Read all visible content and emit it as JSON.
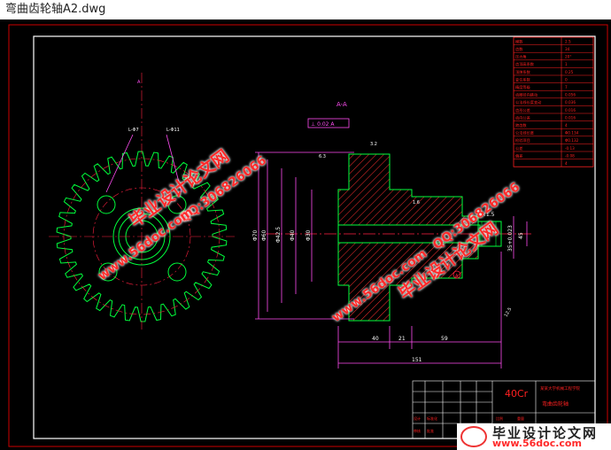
{
  "window": {
    "title": "弯曲齿轮轴A2.dwg"
  },
  "drawing": {
    "section_label": "A-A",
    "material": "40Cr",
    "dims": {
      "d1": "Φ70",
      "d2": "Φ60",
      "d3": "Φ42.5",
      "d4": "Φ40",
      "d5": "Φ30",
      "len_40": "40",
      "len_21": "21",
      "len_59": "59",
      "len_151": "151",
      "right_key": "45",
      "right_fit": "35+0.023",
      "thread_note": "5×1.5"
    },
    "roughness": [
      "6.3",
      "3.2",
      "1.6",
      "12.5"
    ],
    "tolerance_frame": "⊥ 0.02 A",
    "datum": "A",
    "gear_labels": [
      "L-Φ7",
      "L-Φ11",
      "A"
    ],
    "param_table_rows": [
      "模数",
      "齿数",
      "压力角",
      "齿顶高系数",
      "顶隙系数",
      "变位系数",
      "精度等级",
      "齿圈径向跳动",
      "公法线长度变动",
      "齿形公差",
      "齿向公差",
      "跨齿数",
      "公法线长度",
      "检验项目",
      "公差",
      "偏差"
    ],
    "param_table_values": [
      "2.5",
      "34",
      "20°",
      "1",
      "0.25",
      "0",
      "7",
      "0.056",
      "0.036",
      "0.016",
      "0.016",
      "4",
      "Φ0.134",
      "Φ0.132",
      "-0.13",
      "-0.08",
      "4"
    ],
    "title_block": {
      "school": "某某大学机械工程学院",
      "name": "弯曲齿轮轴",
      "cells": [
        "设计",
        "审核",
        "标准化",
        "批准",
        "比例",
        "重量"
      ]
    }
  },
  "watermarks": {
    "left_cn": "毕业设计论文网",
    "left_qq": "QQ:306826066",
    "left_url": "www.56doc.com",
    "mid_cn": "毕业设计论文网",
    "mid_qq": "QQ:306826066",
    "mid_url": "www.56doc.com",
    "bottom_cn": "毕业设计论文网",
    "bottom_url": "www.56doc.com"
  },
  "colors": {
    "background": "#000000",
    "frame": "#ffffff",
    "gear": "#00ff3c",
    "dimension": "#ff4df2",
    "hatch": "#ff3030",
    "center": "#ff2040",
    "table": "#ff2020",
    "cyan": "#00ffff",
    "yellow": "#ffff00"
  }
}
